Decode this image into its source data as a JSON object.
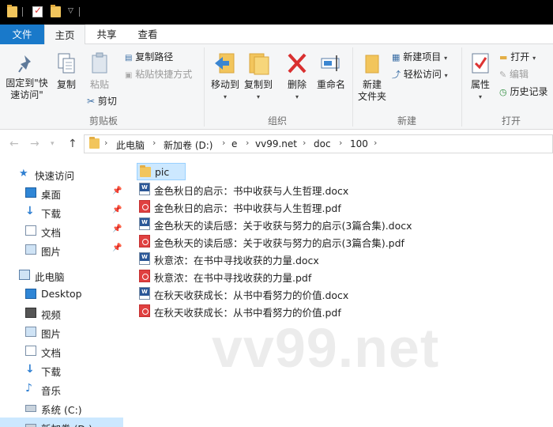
{
  "quick_access_toolbar": {
    "icons": [
      "folder-icon",
      "properties-check-icon",
      "new-folder-icon",
      "customize-dropdown-icon"
    ]
  },
  "ribbon_tabs": [
    {
      "label": "文件"
    },
    {
      "label": "主页"
    },
    {
      "label": "共享"
    },
    {
      "label": "查看"
    }
  ],
  "ribbon": {
    "clipboard": {
      "pin_label_1": "固定到\"快",
      "pin_label_2": "速访问\"",
      "copy": "复制",
      "paste": "粘贴",
      "copy_path": "复制路径",
      "paste_shortcut": "粘贴快捷方式",
      "cut": "剪切",
      "group": "剪贴板"
    },
    "organize": {
      "move_to": "移动到",
      "copy_to": "复制到",
      "delete": "删除",
      "rename": "重命名",
      "group": "组织"
    },
    "new": {
      "new_folder_1": "新建",
      "new_folder_2": "文件夹",
      "new_item": "新建项目",
      "easy_access": "轻松访问",
      "group": "新建"
    },
    "open": {
      "properties": "属性",
      "open": "打开",
      "edit": "编辑",
      "history": "历史记录",
      "group": "打开"
    }
  },
  "address_bar": {
    "breadcrumbs": [
      "此电脑",
      "新加卷 (D:)",
      "e",
      "vv99.net",
      "doc",
      "100"
    ]
  },
  "nav_pane": {
    "items": [
      {
        "label": "快速访问",
        "icon": "star-icon"
      },
      {
        "label": "桌面",
        "icon": "desktop-icon",
        "pinned": true
      },
      {
        "label": "下载",
        "icon": "download-icon",
        "pinned": true
      },
      {
        "label": "文档",
        "icon": "documents-icon",
        "pinned": true
      },
      {
        "label": "图片",
        "icon": "pictures-icon",
        "pinned": true
      },
      {
        "label": "此电脑",
        "icon": "computer-icon"
      },
      {
        "label": "Desktop",
        "icon": "desktop-icon"
      },
      {
        "label": "视频",
        "icon": "videos-icon"
      },
      {
        "label": "图片",
        "icon": "pictures-icon"
      },
      {
        "label": "文档",
        "icon": "documents-icon"
      },
      {
        "label": "下载",
        "icon": "download-icon"
      },
      {
        "label": "音乐",
        "icon": "music-icon"
      },
      {
        "label": "系统 (C:)",
        "icon": "drive-icon"
      },
      {
        "label": "新加卷 (D:)",
        "icon": "drive-icon",
        "selected": true
      }
    ]
  },
  "files": [
    {
      "name": "pic",
      "type": "folder",
      "selected": true
    },
    {
      "name": "金色秋日的启示：书中收获与人生哲理.docx",
      "type": "docx"
    },
    {
      "name": "金色秋日的启示：书中收获与人生哲理.pdf",
      "type": "pdf"
    },
    {
      "name": "金色秋天的读后感：关于收获与努力的启示(3篇合集).docx",
      "type": "docx"
    },
    {
      "name": "金色秋天的读后感：关于收获与努力的启示(3篇合集).pdf",
      "type": "pdf"
    },
    {
      "name": "秋意浓：在书中寻找收获的力量.docx",
      "type": "docx"
    },
    {
      "name": "秋意浓：在书中寻找收获的力量.pdf",
      "type": "pdf"
    },
    {
      "name": "在秋天收获成长：从书中看努力的价值.docx",
      "type": "docx"
    },
    {
      "name": "在秋天收获成长：从书中看努力的价值.pdf",
      "type": "pdf"
    }
  ],
  "watermark": "vv99.net",
  "colors": {
    "accent": "#1979ca",
    "selection": "#cce8ff",
    "folder": "#f2c55c",
    "pdf": "#e04040",
    "word": "#2b5797"
  }
}
